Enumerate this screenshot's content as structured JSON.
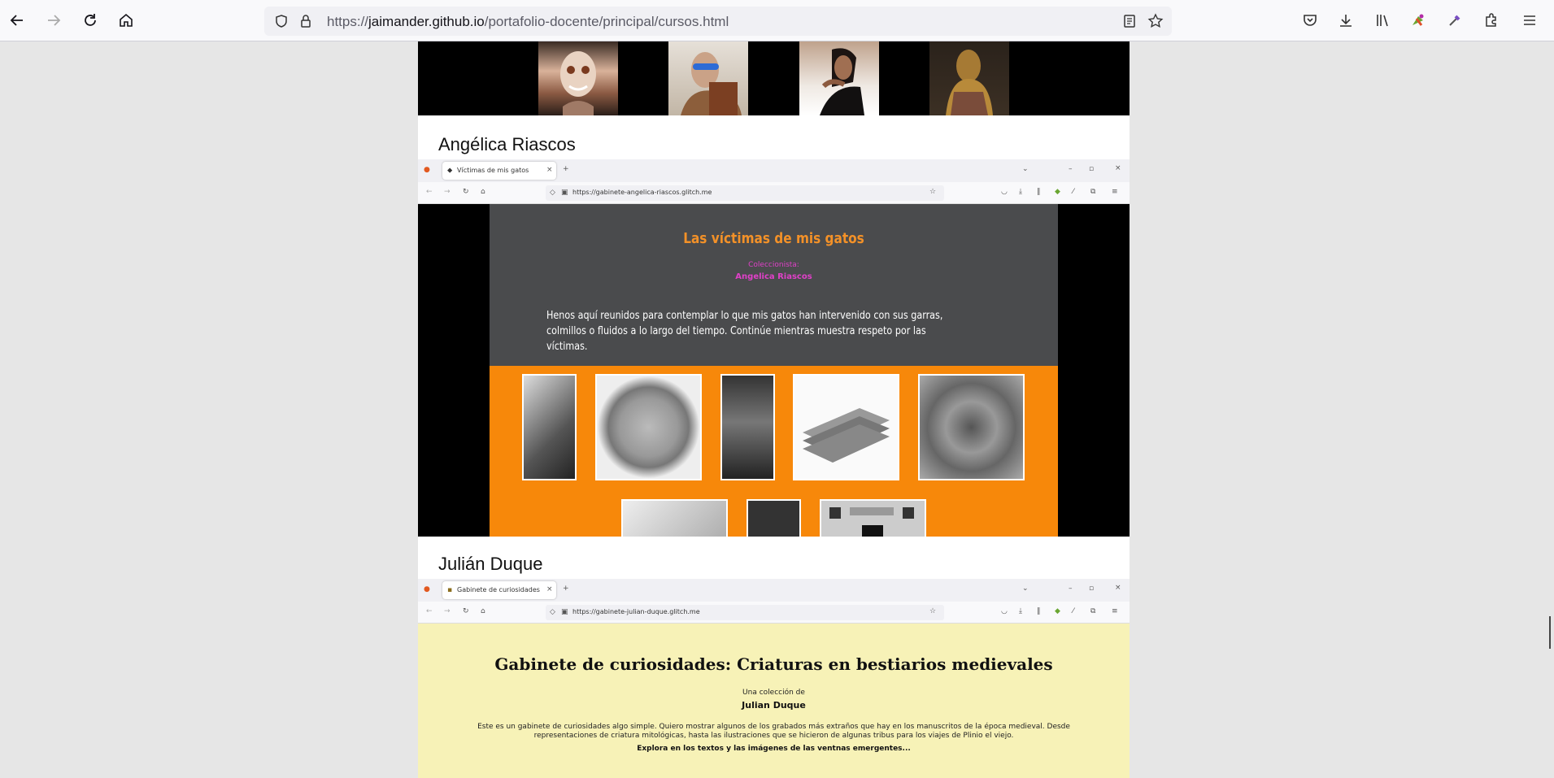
{
  "browser": {
    "url_prefix": "https://",
    "url_host": "jaimander.github.io",
    "url_path": "/portafolio-docente/principal/cursos.html"
  },
  "sections": {
    "angelica": {
      "name": "Angélica Riascos",
      "tab_title": "Víctimas de mis gatos",
      "url": "https://gabinete-angelica-riascos.glitch.me",
      "site_title": "Las víctimas de mis gatos",
      "collector_label": "Coleccionista:",
      "collector_name": "Angelica Riascos",
      "description": "Henos aquí reunidos para contemplar lo que mis gatos han intervenido con sus garras, colmillos o fluidos a lo largo del tiempo. Continúe mientras muestra respeto por las víctimas."
    },
    "julian": {
      "name": "Julián Duque",
      "tab_title": "Gabinete de curiosidades",
      "url": "https://gabinete-julian-duque.glitch.me",
      "site_title": "Gabinete de curiosidades: Criaturas en bestiarios medievales",
      "collection_label": "Una colección de",
      "collector_name": "Julian Duque",
      "description": "Este es un gabinete de curiosidades algo simple. Quiero mostrar algunos de los grabados más extraños que hay en los manuscritos de la época medieval. Desde representaciones de criatura mitológicas, hasta las ilustraciones que se hicieron de algunas tribus para los viajes de Plinio el viejo.",
      "explore": "Explora en los textos y las imágenes de las ventnas emergentes..."
    }
  },
  "icons": [
    "back-icon",
    "forward-icon",
    "reload-icon",
    "home-icon",
    "shield-icon",
    "lock-icon",
    "reader-icon",
    "star-icon",
    "pocket-icon",
    "download-icon",
    "library-icon",
    "extension-icon",
    "eyedropper-icon",
    "puzzle-icon",
    "menu-icon"
  ],
  "colors": {
    "gatos_title": "#f39128",
    "gatos_orange": "#f7880a",
    "gatos_magenta": "#e040c8",
    "julian_bg": "#f7f2b7"
  }
}
